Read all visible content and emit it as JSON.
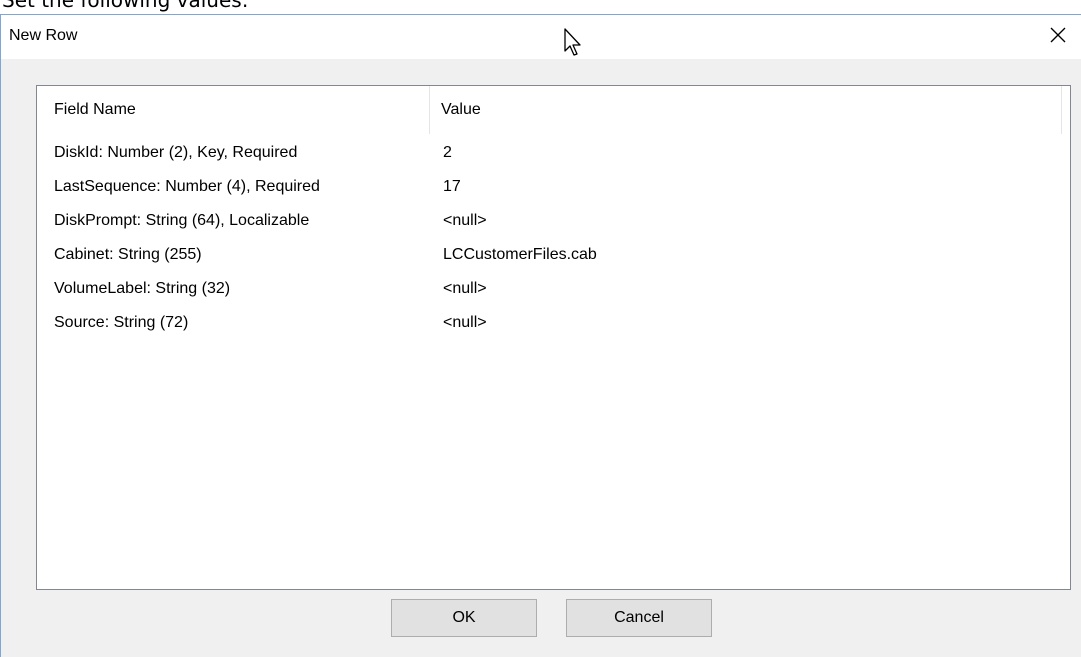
{
  "instruction": "Set the following values:",
  "dialog": {
    "title": "New Row",
    "close_glyph": "✕",
    "columns": {
      "field_name": "Field Name",
      "value": "Value"
    },
    "rows": [
      {
        "field": "DiskId: Number (2), Key, Required",
        "value": "2"
      },
      {
        "field": "LastSequence: Number (4), Required",
        "value": "17"
      },
      {
        "field": "DiskPrompt: String (64), Localizable",
        "value": "<null>"
      },
      {
        "field": "Cabinet: String (255)",
        "value": "LCCustomerFiles.cab"
      },
      {
        "field": "VolumeLabel: String (32)",
        "value": "<null>"
      },
      {
        "field": "Source: String (72)",
        "value": "<null>"
      }
    ],
    "buttons": {
      "ok": "OK",
      "cancel": "Cancel"
    }
  },
  "icons": {
    "close": "close-icon",
    "cursor": "mouse-pointer-icon"
  }
}
